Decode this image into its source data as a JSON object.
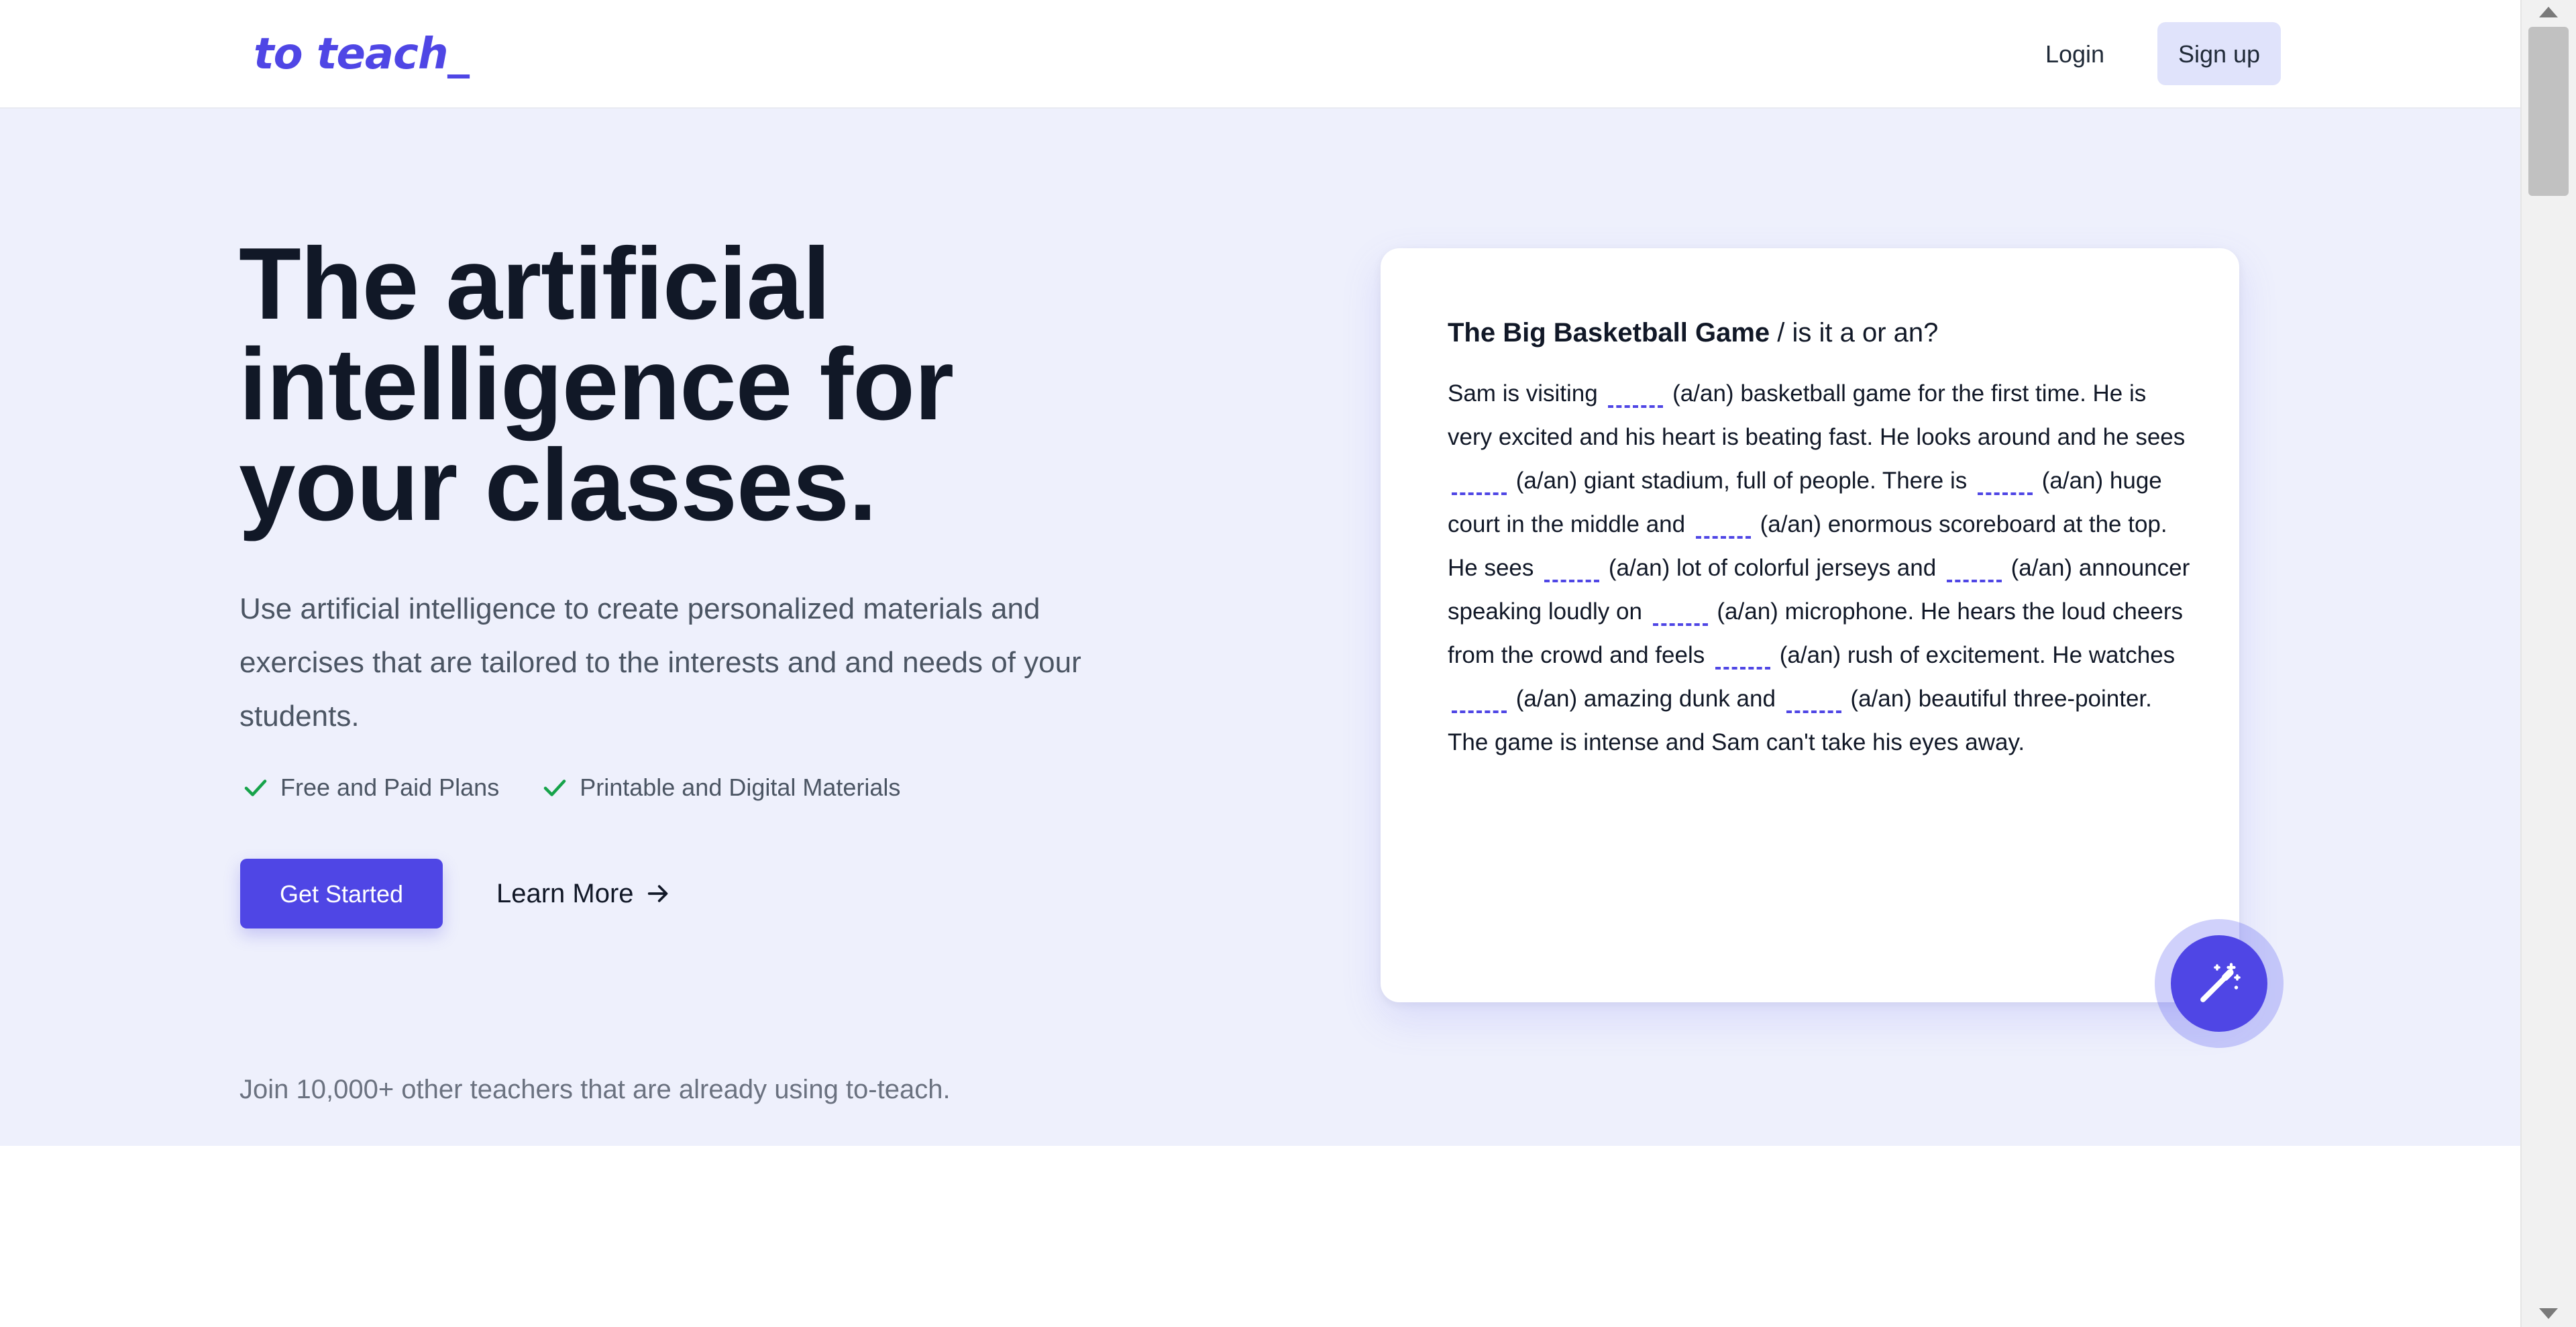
{
  "header": {
    "logo": "to teach_",
    "login_label": "Login",
    "signup_label": "Sign up"
  },
  "hero": {
    "headline": "The artificial intelligence for your classes.",
    "subtext": "Use artificial intelligence to create personalized materials and exercises that are tailored to the interests and and needs of your students.",
    "features": [
      {
        "label": "Free and Paid Plans",
        "icon": "check-icon"
      },
      {
        "label": "Printable and Digital Materials",
        "icon": "check-icon"
      }
    ],
    "get_started_label": "Get Started",
    "learn_more_label": "Learn More",
    "join_text": "Join 10,000+ other teachers that are already using to-teach."
  },
  "example": {
    "title": "The Big Basketball Game",
    "subtitle": " / is it a or an?",
    "hint": "(a/an)",
    "segments": [
      "Sam is visiting",
      "basketball game for the first time. He is very excited and his heart is beating fast. He looks around and he sees",
      "giant stadium, full of people. There is",
      "huge court in the middle and",
      "enormous scoreboard at the top. He sees",
      "lot of colorful jerseys and",
      "announcer speaking loudly on",
      "microphone. He hears the loud cheers from the crowd and feels",
      "rush of excitement. He watches",
      "amazing dunk and",
      "beautiful three-pointer. The game is intense and Sam can't take his eyes away."
    ],
    "action_icon": "magic-wand-icon"
  },
  "colors": {
    "brand": "#4f46e5",
    "hero_background": "#eef0fc",
    "signup_background": "#e0e3fb",
    "check": "#16a34a"
  }
}
